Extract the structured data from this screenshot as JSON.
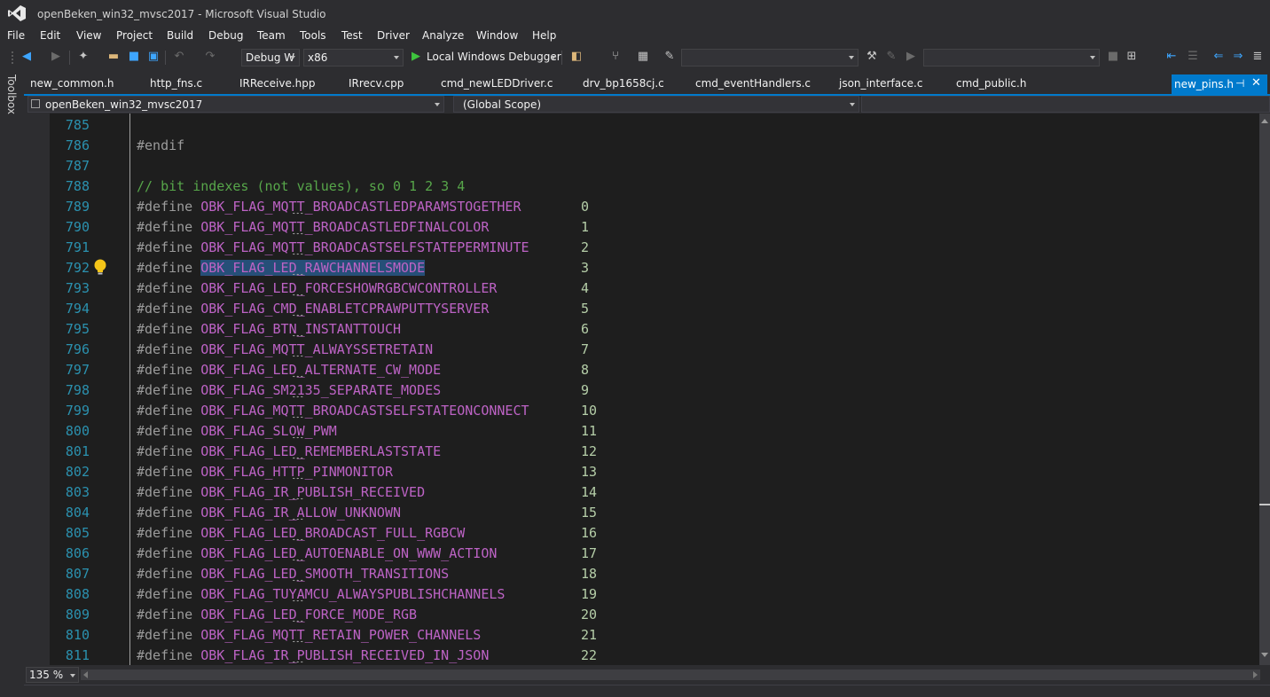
{
  "window": {
    "title": "openBeken_win32_mvsc2017 - Microsoft Visual Studio",
    "logo_icon": "visual-studio-logo"
  },
  "menu": [
    "File",
    "Edit",
    "View",
    "Project",
    "Build",
    "Debug",
    "Team",
    "Tools",
    "Test",
    "Driver",
    "Analyze",
    "Window",
    "Help"
  ],
  "toolbar": {
    "configuration": "Debug W",
    "platform": "x86",
    "run_label": "Local Windows Debugger",
    "icons": [
      "back-icon",
      "forward-icon",
      "new-project-icon",
      "open-file-icon",
      "save-icon",
      "save-all-icon",
      "undo-icon",
      "redo-icon",
      "start-debug-icon",
      "attach-icon",
      "source-control-icon",
      "find-icon",
      "breakpoint-icon",
      "comment-icon",
      "uncomment-icon",
      "indent-icon",
      "outdent-icon"
    ]
  },
  "side_panel": {
    "toolbox_label": "Toolbox"
  },
  "tabs": [
    "new_common.h",
    "http_fns.c",
    "IRReceive.hpp",
    "IRrecv.cpp",
    "cmd_newLEDDriver.c",
    "drv_bp1658cj.c",
    "cmd_eventHandlers.c",
    "json_interface.c",
    "cmd_public.h"
  ],
  "active_tab": {
    "label": "new_pins.h",
    "pin_icon": "pin-icon",
    "close_icon": "close-icon"
  },
  "navigation": {
    "project": "openBeken_win32_mvsc2017",
    "scope": "(Global Scope)",
    "member": ""
  },
  "editor": {
    "accent_colors": {
      "line_number": "#2b91af",
      "macro": "#bd63c5",
      "preprocessor": "#9b9b9b",
      "number": "#b5cea8",
      "comment": "#57a64a",
      "selection": "#264f78"
    },
    "selected_line": "792",
    "lines": [
      {
        "n": "785",
        "kind": "blank",
        "text": ""
      },
      {
        "n": "786",
        "kind": "preproc",
        "text": "#endif"
      },
      {
        "n": "787",
        "kind": "blank",
        "text": ""
      },
      {
        "n": "788",
        "kind": "comment",
        "text": "// bit indexes (not values), so 0 1 2 3 4"
      },
      {
        "n": "789",
        "kind": "define",
        "macro": "OBK_FLAG_MQTT_BROADCASTLEDPARAMSTOGETHER",
        "value": "0"
      },
      {
        "n": "790",
        "kind": "define",
        "macro": "OBK_FLAG_MQTT_BROADCASTLEDFINALCOLOR",
        "value": "1"
      },
      {
        "n": "791",
        "kind": "define",
        "macro": "OBK_FLAG_MQTT_BROADCASTSELFSTATEPERMINUTE",
        "value": "2"
      },
      {
        "n": "792",
        "kind": "define",
        "macro": "OBK_FLAG_LED_RAWCHANNELSMODE",
        "value": "3"
      },
      {
        "n": "793",
        "kind": "define",
        "macro": "OBK_FLAG_LED_FORCESHOWRGBCWCONTROLLER",
        "value": "4"
      },
      {
        "n": "794",
        "kind": "define",
        "macro": "OBK_FLAG_CMD_ENABLETCPRAWPUTTYSERVER",
        "value": "5"
      },
      {
        "n": "795",
        "kind": "define",
        "macro": "OBK_FLAG_BTN_INSTANTTOUCH",
        "value": "6"
      },
      {
        "n": "796",
        "kind": "define",
        "macro": "OBK_FLAG_MQTT_ALWAYSSETRETAIN",
        "value": "7"
      },
      {
        "n": "797",
        "kind": "define",
        "macro": "OBK_FLAG_LED_ALTERNATE_CW_MODE",
        "value": "8"
      },
      {
        "n": "798",
        "kind": "define",
        "macro": "OBK_FLAG_SM2135_SEPARATE_MODES",
        "value": "9"
      },
      {
        "n": "799",
        "kind": "define",
        "macro": "OBK_FLAG_MQTT_BROADCASTSELFSTATEONCONNECT",
        "value": "10"
      },
      {
        "n": "800",
        "kind": "define",
        "macro": "OBK_FLAG_SLOW_PWM",
        "value": "11"
      },
      {
        "n": "801",
        "kind": "define",
        "macro": "OBK_FLAG_LED_REMEMBERLASTSTATE",
        "value": "12"
      },
      {
        "n": "802",
        "kind": "define",
        "macro": "OBK_FLAG_HTTP_PINMONITOR",
        "value": "13"
      },
      {
        "n": "803",
        "kind": "define",
        "macro": "OBK_FLAG_IR_PUBLISH_RECEIVED",
        "value": "14"
      },
      {
        "n": "804",
        "kind": "define",
        "macro": "OBK_FLAG_IR_ALLOW_UNKNOWN",
        "value": "15"
      },
      {
        "n": "805",
        "kind": "define",
        "macro": "OBK_FLAG_LED_BROADCAST_FULL_RGBCW",
        "value": "16"
      },
      {
        "n": "806",
        "kind": "define",
        "macro": "OBK_FLAG_LED_AUTOENABLE_ON_WWW_ACTION",
        "value": "17"
      },
      {
        "n": "807",
        "kind": "define",
        "macro": "OBK_FLAG_LED_SMOOTH_TRANSITIONS",
        "value": "18"
      },
      {
        "n": "808",
        "kind": "define",
        "macro": "OBK_FLAG_TUYAMCU_ALWAYSPUBLISHCHANNELS",
        "value": "19"
      },
      {
        "n": "809",
        "kind": "define",
        "macro": "OBK_FLAG_LED_FORCE_MODE_RGB",
        "value": "20"
      },
      {
        "n": "810",
        "kind": "define",
        "macro": "OBK_FLAG_MQTT_RETAIN_POWER_CHANNELS",
        "value": "21"
      },
      {
        "n": "811",
        "kind": "define",
        "macro": "OBK_FLAG_IR_PUBLISH_RECEIVED_IN_JSON",
        "value": "22"
      }
    ],
    "define_keyword": "#define",
    "lightbulb_icon": "lightbulb-icon"
  },
  "status": {
    "zoom": "135 %"
  }
}
